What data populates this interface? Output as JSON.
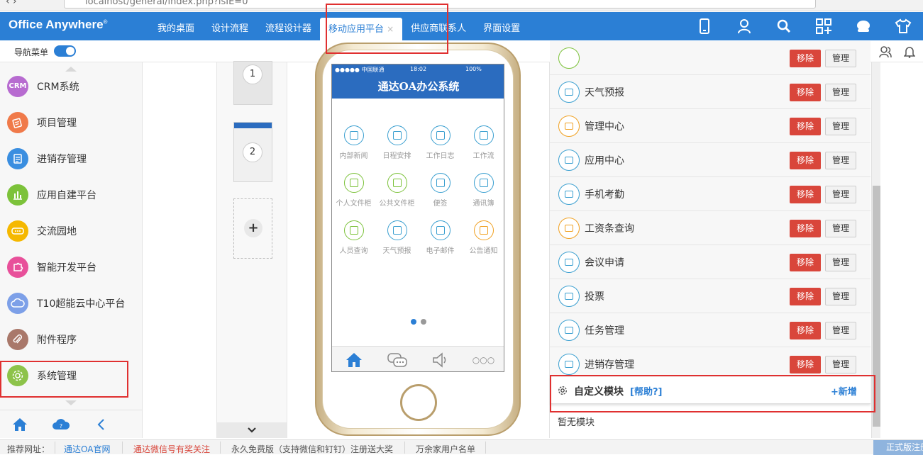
{
  "browser": {
    "url": "localhost/general/index.php?isIE=0"
  },
  "header": {
    "logo": "Office Anywhere",
    "logo_mark": "®",
    "tabs": [
      {
        "label": "我的桌面"
      },
      {
        "label": "设计流程"
      },
      {
        "label": "流程设计器"
      },
      {
        "label": "移动应用平台",
        "active": true,
        "close": "×"
      },
      {
        "label": "供应商联系人"
      },
      {
        "label": "界面设置"
      }
    ],
    "icons": [
      "mobile-icon",
      "user-icon",
      "search-icon",
      "apps-grid-icon",
      "chat-icon",
      "shirt-icon"
    ]
  },
  "subbar": {
    "nav_menu_label": "导航菜单",
    "toggle_on": true
  },
  "sidebar": {
    "items": [
      {
        "label": "CRM系统",
        "badge": "CRM",
        "color": "#b76bd0"
      },
      {
        "label": "项目管理",
        "color": "#f07a4a"
      },
      {
        "label": "进销存管理",
        "color": "#3a8ee0"
      },
      {
        "label": "应用自建平台",
        "color": "#7cc23a"
      },
      {
        "label": "交流园地",
        "color": "#f5b800"
      },
      {
        "label": "智能开发平台",
        "color": "#e8509a"
      },
      {
        "label": "T10超能云中心平台",
        "color": "#7da0e8"
      },
      {
        "label": "附件程序",
        "color": "#a9786a"
      },
      {
        "label": "系统管理",
        "color": "#8dc34a"
      }
    ]
  },
  "thumbnails": {
    "pages": [
      "1",
      "2"
    ],
    "add": "+"
  },
  "phone": {
    "carrier": "●●●●● 中国联通",
    "time": "18:02",
    "battery": "100%",
    "title": "通达OA办公系统",
    "apps": [
      {
        "label": "内部新闻",
        "color": "#3a9fd0"
      },
      {
        "label": "日程安排",
        "color": "#3a9fd0"
      },
      {
        "label": "工作日志",
        "color": "#3a9fd0"
      },
      {
        "label": "工作流",
        "color": "#3a9fd0"
      },
      {
        "label": "个人文件柜",
        "color": "#7cc23a"
      },
      {
        "label": "公共文件柜",
        "color": "#7cc23a"
      },
      {
        "label": "便签",
        "color": "#3a9fd0"
      },
      {
        "label": "通讯簿",
        "color": "#3a9fd0"
      },
      {
        "label": "人员查询",
        "color": "#7cc23a"
      },
      {
        "label": "天气预报",
        "color": "#3a9fd0"
      },
      {
        "label": "电子邮件",
        "color": "#3a9fd0"
      },
      {
        "label": "公告通知",
        "color": "#f0a020"
      }
    ],
    "more": "○○○"
  },
  "modules": {
    "remove_label": "移除",
    "manage_label": "管理",
    "items": [
      {
        "name": "天气预报",
        "color": "#3a9fd0"
      },
      {
        "name": "管理中心",
        "color": "#f0a020"
      },
      {
        "name": "应用中心",
        "color": "#3a9fd0"
      },
      {
        "name": "手机考勤",
        "color": "#3a9fd0"
      },
      {
        "name": "工资条查询",
        "color": "#f0a020"
      },
      {
        "name": "会议申请",
        "color": "#3a9fd0"
      },
      {
        "name": "投票",
        "color": "#3a9fd0"
      },
      {
        "name": "任务管理",
        "color": "#3a9fd0"
      },
      {
        "name": "进销存管理",
        "color": "#3a9fd0"
      }
    ],
    "custom_title": "自定义模块",
    "help": "[帮助?]",
    "add": "+新增",
    "empty": "暂无模块"
  },
  "footer": {
    "prefix": "推荐网址：",
    "links": [
      "通达OA官网",
      "通达微信号有奖关注",
      "永久免费版（支持微信和钉钉）注册送大奖",
      "万余家用户名单"
    ],
    "cta": "正式版注册"
  },
  "colors": {
    "primary": "#2b7fd5",
    "danger": "#d9463b",
    "highlight": "#e03030"
  }
}
